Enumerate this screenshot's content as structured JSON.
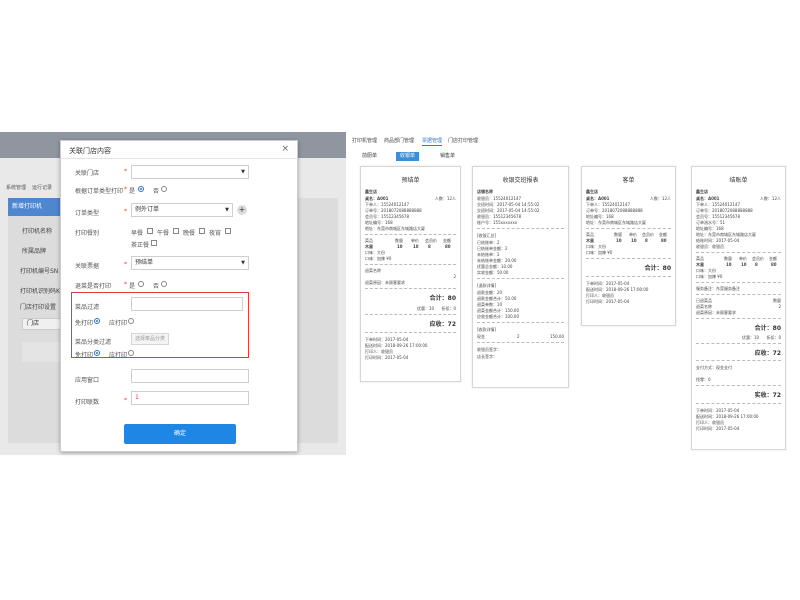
{
  "behind": {
    "nav_tabs": [
      "系统管理",
      "运行记录"
    ],
    "panel_title": "新增打印机",
    "labels": [
      "打印机名称",
      "所属品牌",
      "打印机编号SN",
      "打印机识别码KEY",
      "门店打印设置"
    ],
    "table_cell": "门店"
  },
  "modal": {
    "title": "关联门店内容",
    "close": "×",
    "fields": {
      "store_label": "关联门店",
      "by_order_label": "根据订单类型打印",
      "yes": "是",
      "no": "否",
      "order_type_label": "订单类型",
      "order_type_value": "例外订单",
      "meals_label": "打印餐别",
      "meals": [
        "早餐",
        "午餐",
        "晚餐",
        "夜宵",
        "茶正餐"
      ],
      "ticket_label": "关联票据",
      "ticket_value": "预结单",
      "return_label": "退菜是否打印",
      "dish_filter_label": "菜品过滤",
      "dish_free": "免打印",
      "dish_print": "应打印",
      "cat_filter_label": "菜品分类过滤",
      "cat_button": "选择菜品分类",
      "cat_free": "免打印",
      "cat_print": "应打印",
      "port_label": "应用窗口",
      "copies_label": "打印联数",
      "copies_value": "1"
    },
    "confirm": "确定"
  },
  "right": {
    "tabs": [
      "打印机管理",
      "商品部门管理",
      "票据管理",
      "门店打印管理"
    ],
    "active_tab": 2,
    "subtabs": [
      "前厨单",
      "收银单",
      "销售单"
    ],
    "active_subtab": 1,
    "r1": {
      "title": "预结单",
      "shop": "鑫生店",
      "table": "桌名：A001",
      "people": "人数：12人",
      "lines": [
        "下单人：15524012147",
        "订单号：2018072088888888",
        "会员号：15512345678",
        "地址编号：168",
        "地址：东莞市南城区东城路店大厦"
      ],
      "hdr": [
        "菜品",
        "数量",
        "单价",
        "会员价",
        "金额"
      ],
      "row1": [
        "木鼠",
        "10",
        "10",
        "8",
        "80"
      ],
      "row2": "口味：大份",
      "row3": "口味：加辣  ¥0",
      "ret": "退菜名称",
      "ret_qty": "2",
      "ret_note": "退菜原因：未顾客要求",
      "total_label": "合计：",
      "total": "80",
      "disc": "优惠：10",
      "rate": "折扣：0",
      "pay_label": "应收：",
      "pay": "72",
      "foot": [
        "下单时间：2017-05-04",
        "配送时间：2018-09-26 17:00:00",
        "打印人：收银员",
        "打印时间：2017-05-04"
      ]
    },
    "r2": {
      "title": "收银交班报表",
      "lines": [
        "店铺名称",
        "收银员：15524012147",
        "交班时间：2017-05-04 14:55:02",
        "交班时间：2017-05-04 14:55:02",
        "收银员：15512345678",
        "账户号：155xxxxxxx"
      ],
      "sec1": "[收银汇总]",
      "sec1_lines": [
        "已结账单：2",
        "已结账单金额：2",
        "未结账单：2",
        "未结账单金额：20.00",
        "优惠总金额：10.00",
        "实收金额：50.00"
      ],
      "sec2": "[退款详情]",
      "sec2_lines": [
        "退款金额：20",
        "退款金额合计：50.00",
        "退菜单数：10",
        "退菜金额合计：150.00",
        "应收金额合计：100.00"
      ],
      "sec3": "[收款详情]",
      "sec3_row": [
        "现金",
        "2",
        "150.00"
      ],
      "foot": [
        "收银员签字：",
        "店长签字："
      ]
    },
    "r3": {
      "title": "客单",
      "shop": "鑫生店",
      "table": "桌名：A001",
      "people": "人数：12人",
      "lines": [
        "下单人：15524012147",
        "订单号：2018072088888888",
        "地址编号：168",
        "地址：东莞市南城区东城路店大厦"
      ],
      "hdr": [
        "菜品",
        "数量",
        "单价",
        "会员价",
        "金额"
      ],
      "row1": [
        "木鼠",
        "10",
        "10",
        "8",
        "80"
      ],
      "row2": "口味：大份",
      "row3": "口味：加辣  ¥0",
      "total_label": "合计：",
      "total": "80",
      "foot": [
        "下单时间：2017-05-04",
        "配送时间：2018-09-26 17:00:00",
        "打印人：收银员",
        "打印时间：2017-05-04"
      ]
    },
    "r4": {
      "title": "结账单",
      "shop": "鑫生店",
      "table": "桌名：A001",
      "people": "人数：12人",
      "lines": [
        "下单人：15524012147",
        "订单号：2018072088888888",
        "会员号：15512345678",
        "订单流水号：51",
        "地址编号：168",
        "地址：东莞市南城区东城路店大厦",
        "结账时间：2017-05-04",
        "收银员：收银员"
      ],
      "hdr": [
        "菜品",
        "数量",
        "单价",
        "会员价",
        "金额"
      ],
      "row1": [
        "木鼠",
        "10",
        "10",
        "8",
        "80"
      ],
      "row2": "口味：大份",
      "row3": "口味：加辣  ¥0",
      "dept": "服务备注：东莞服务备注",
      "ret": "已退菜品",
      "ret_qty": "数量",
      "ret_name": "退菜名称",
      "ret_num": "2",
      "ret_note": "退菜原因：未顾客要求",
      "total_label": "合计：",
      "total": "80",
      "disc": "优惠：10",
      "rate": "折扣：0",
      "pay_label": "应收：",
      "pay": "72",
      "pay_method": "支付方式：现金支付",
      "change": "找零：0",
      "real_label": "实收：",
      "real": "72",
      "foot": [
        "下单时间：2017-05-04",
        "配送时间：2018-09-26 17:00:00",
        "打印人：收银员",
        "打印时间：2017-05-04"
      ]
    }
  }
}
